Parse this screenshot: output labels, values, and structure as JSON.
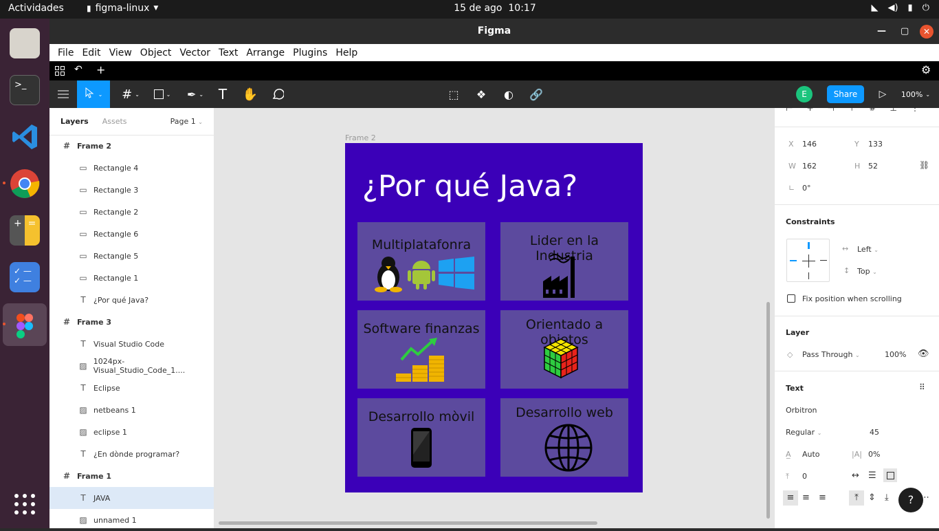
{
  "system": {
    "activities": "Actividades",
    "app_name": "figma-linux",
    "date": "15 de ago",
    "time": "10:17"
  },
  "window": {
    "title": "Figma"
  },
  "menu": [
    "File",
    "Edit",
    "View",
    "Object",
    "Vector",
    "Text",
    "Arrange",
    "Plugins",
    "Help"
  ],
  "toolbar": {
    "avatar_letter": "E",
    "share_label": "Share",
    "zoom": "100%"
  },
  "left_panel": {
    "tabs": {
      "layers": "Layers",
      "assets": "Assets",
      "page": "Page 1"
    },
    "layers": [
      {
        "type": "frame",
        "name": "Frame 2"
      },
      {
        "type": "rect",
        "name": "Rectangle 4"
      },
      {
        "type": "rect",
        "name": "Rectangle 3"
      },
      {
        "type": "rect",
        "name": "Rectangle 2"
      },
      {
        "type": "rect",
        "name": "Rectangle 6"
      },
      {
        "type": "rect",
        "name": "Rectangle 5"
      },
      {
        "type": "rect",
        "name": "Rectangle 1"
      },
      {
        "type": "text",
        "name": "¿Por qué Java?"
      },
      {
        "type": "frame",
        "name": "Frame 3"
      },
      {
        "type": "text",
        "name": "Visual Studio Code"
      },
      {
        "type": "image",
        "name": "1024px-Visual_Studio_Code_1...."
      },
      {
        "type": "text",
        "name": "Eclipse"
      },
      {
        "type": "image",
        "name": "netbeans 1"
      },
      {
        "type": "image",
        "name": "eclipse 1"
      },
      {
        "type": "text",
        "name": "¿En dònde programar?"
      },
      {
        "type": "frame",
        "name": "Frame 1"
      },
      {
        "type": "text",
        "name": "JAVA"
      },
      {
        "type": "image",
        "name": "unnamed 1"
      }
    ]
  },
  "canvas": {
    "frame_label": "Frame 2",
    "title": "¿Por qué Java?",
    "cards": [
      "Multiplatafonra",
      "Lider en la Industria",
      "Software finanzas",
      "Orientado a objetos",
      "Desarrollo mòvil",
      "Desarrollo web"
    ]
  },
  "right_panel": {
    "x_label": "X",
    "x": "146",
    "y_label": "Y",
    "y": "133",
    "w_label": "W",
    "w": "162",
    "h_label": "H",
    "h": "52",
    "rotation": "0°",
    "constraints_title": "Constraints",
    "constraint_h": "Left",
    "constraint_v": "Top",
    "fix_position": "Fix position when scrolling",
    "layer_title": "Layer",
    "blend": "Pass Through",
    "opacity": "100%",
    "text_title": "Text",
    "font": "Orbitron",
    "weight": "Regular",
    "size": "45",
    "line_height": "Auto",
    "letter_spacing": "0%",
    "paragraph_spacing": "0"
  },
  "colors": {
    "accent": "#0d99ff",
    "frame": "#3b00b8",
    "card": "#5c4a9e"
  }
}
